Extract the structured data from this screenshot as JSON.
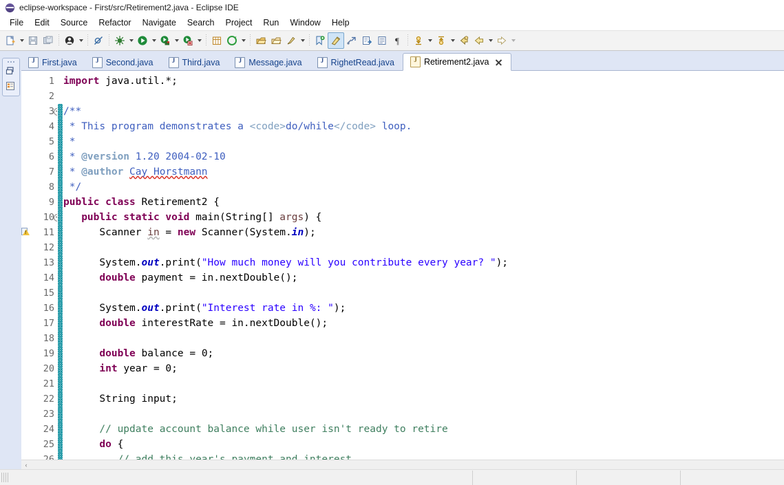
{
  "window": {
    "title": "eclipse-workspace - First/src/Retirement2.java - Eclipse IDE",
    "logo_icon": "eclipse-logo-icon"
  },
  "menubar": {
    "items": [
      {
        "label": "File"
      },
      {
        "label": "Edit"
      },
      {
        "label": "Source"
      },
      {
        "label": "Refactor"
      },
      {
        "label": "Navigate"
      },
      {
        "label": "Search"
      },
      {
        "label": "Project"
      },
      {
        "label": "Run"
      },
      {
        "label": "Window"
      },
      {
        "label": "Help"
      }
    ]
  },
  "toolbar": {
    "buttons": [
      {
        "name": "new-wizard-icon",
        "kind": "new"
      },
      {
        "name": "new-dropdown-caret",
        "kind": "caret"
      },
      {
        "name": "save-icon",
        "kind": "save"
      },
      {
        "name": "save-all-icon",
        "kind": "saveall"
      },
      {
        "name": "sep1",
        "kind": "sep"
      },
      {
        "name": "user-profile-icon",
        "kind": "user"
      },
      {
        "name": "user-dropdown-caret",
        "kind": "caret"
      },
      {
        "name": "sep2",
        "kind": "sep"
      },
      {
        "name": "skip-breakpoints-icon",
        "kind": "skipbreak"
      },
      {
        "name": "sep3",
        "kind": "sep"
      },
      {
        "name": "debug-icon",
        "kind": "debug"
      },
      {
        "name": "debug-dropdown-caret",
        "kind": "caret"
      },
      {
        "name": "run-icon",
        "kind": "run"
      },
      {
        "name": "run-dropdown-caret",
        "kind": "caret"
      },
      {
        "name": "run-external-tools-icon",
        "kind": "exttool"
      },
      {
        "name": "external-tools-caret",
        "kind": "caret"
      },
      {
        "name": "coverage-icon",
        "kind": "coverage"
      },
      {
        "name": "coverage-caret",
        "kind": "caret"
      },
      {
        "name": "sep4",
        "kind": "sep"
      },
      {
        "name": "new-java-package-icon",
        "kind": "package"
      },
      {
        "name": "new-java-project-icon",
        "kind": "project"
      },
      {
        "name": "project-caret",
        "kind": "caret"
      },
      {
        "name": "sep5",
        "kind": "sep"
      },
      {
        "name": "open-type-icon",
        "kind": "opentype"
      },
      {
        "name": "open-task-icon",
        "kind": "opentask"
      },
      {
        "name": "search-icon",
        "kind": "search"
      },
      {
        "name": "search-caret",
        "kind": "caret"
      },
      {
        "name": "sep6",
        "kind": "sep"
      },
      {
        "name": "new-annotation-icon",
        "kind": "annot"
      },
      {
        "name": "toggle-mark-occurrences-icon",
        "kind": "markocc",
        "selected": true
      },
      {
        "name": "link-with-editor-icon",
        "kind": "linkeditor"
      },
      {
        "name": "next-edit-location-icon",
        "kind": "nextedit"
      },
      {
        "name": "show-whitespace-icon",
        "kind": "whitespace"
      },
      {
        "name": "show-pilcrow-icon",
        "kind": "pilcrow"
      },
      {
        "name": "sep7",
        "kind": "sep"
      },
      {
        "name": "next-annotation-icon",
        "kind": "nextannot"
      },
      {
        "name": "next-annotation-caret",
        "kind": "caret"
      },
      {
        "name": "previous-annotation-icon",
        "kind": "prevannot"
      },
      {
        "name": "previous-annotation-caret",
        "kind": "caret"
      },
      {
        "name": "last-edit-location-icon",
        "kind": "lastedit"
      },
      {
        "name": "back-navigation-icon",
        "kind": "back"
      },
      {
        "name": "back-caret",
        "kind": "caret"
      },
      {
        "name": "forward-navigation-icon",
        "kind": "forward"
      },
      {
        "name": "forward-caret",
        "kind": "caret-dim"
      }
    ]
  },
  "left_rail": {
    "buttons": [
      {
        "name": "restore-view-icon"
      },
      {
        "name": "package-explorer-icon"
      }
    ]
  },
  "editor": {
    "tabs": [
      {
        "label": "First.java",
        "active": false
      },
      {
        "label": "Second.java",
        "active": false
      },
      {
        "label": "Third.java",
        "active": false
      },
      {
        "label": "Message.java",
        "active": false
      },
      {
        "label": "RighetRead.java",
        "active": false
      },
      {
        "label": "Retirement2.java",
        "active": true
      }
    ],
    "lines": [
      {
        "n": 1,
        "fold": false,
        "warn": false,
        "change": false,
        "tokens": [
          {
            "t": "import ",
            "c": "kw"
          },
          {
            "t": "java.util.*;",
            "c": ""
          }
        ]
      },
      {
        "n": 2,
        "fold": false,
        "warn": false,
        "change": false,
        "tokens": []
      },
      {
        "n": 3,
        "fold": true,
        "warn": false,
        "change": true,
        "tokens": [
          {
            "t": "/**",
            "c": "jdoc"
          }
        ]
      },
      {
        "n": 4,
        "fold": false,
        "warn": false,
        "change": true,
        "tokens": [
          {
            "t": " * ",
            "c": "jdoc"
          },
          {
            "t": "This program demonstrates a ",
            "c": "jdoc"
          },
          {
            "t": "<code>",
            "c": "jtag"
          },
          {
            "t": "do/while",
            "c": "jdoc"
          },
          {
            "t": "</code>",
            "c": "jtag"
          },
          {
            "t": " loop.",
            "c": "jdoc"
          }
        ]
      },
      {
        "n": 5,
        "fold": false,
        "warn": false,
        "change": true,
        "tokens": [
          {
            "t": " *",
            "c": "jdoc"
          }
        ]
      },
      {
        "n": 6,
        "fold": false,
        "warn": false,
        "change": true,
        "tokens": [
          {
            "t": " * ",
            "c": "jdoc"
          },
          {
            "t": "@version",
            "c": "jkey"
          },
          {
            "t": " 1.20 2004-02-10",
            "c": "jdoc"
          }
        ]
      },
      {
        "n": 7,
        "fold": false,
        "warn": false,
        "change": true,
        "tokens": [
          {
            "t": " * ",
            "c": "jdoc"
          },
          {
            "t": "@author",
            "c": "jkey"
          },
          {
            "t": " ",
            "c": "jdoc"
          },
          {
            "t": "Cay Horstmann",
            "c": "jdoc spell"
          }
        ]
      },
      {
        "n": 8,
        "fold": false,
        "warn": false,
        "change": true,
        "tokens": [
          {
            "t": " */",
            "c": "jdoc"
          }
        ]
      },
      {
        "n": 9,
        "fold": false,
        "warn": false,
        "change": true,
        "tokens": [
          {
            "t": "public class ",
            "c": "kw"
          },
          {
            "t": "Retirement2 {",
            "c": ""
          }
        ]
      },
      {
        "n": 10,
        "fold": true,
        "warn": false,
        "change": true,
        "tokens": [
          {
            "t": "   ",
            "c": ""
          },
          {
            "t": "public static void ",
            "c": "kw"
          },
          {
            "t": "main(String[] ",
            "c": ""
          },
          {
            "t": "args",
            "c": "loc"
          },
          {
            "t": ") {",
            "c": ""
          }
        ]
      },
      {
        "n": 11,
        "fold": false,
        "warn": true,
        "change": true,
        "tokens": [
          {
            "t": "      Scanner ",
            "c": ""
          },
          {
            "t": "in",
            "c": "loc spellgray"
          },
          {
            "t": " = ",
            "c": ""
          },
          {
            "t": "new ",
            "c": "kw"
          },
          {
            "t": "Scanner(System.",
            "c": ""
          },
          {
            "t": "in",
            "c": "fld"
          },
          {
            "t": ");",
            "c": ""
          }
        ]
      },
      {
        "n": 12,
        "fold": false,
        "warn": false,
        "change": true,
        "tokens": []
      },
      {
        "n": 13,
        "fold": false,
        "warn": false,
        "change": true,
        "tokens": [
          {
            "t": "      System.",
            "c": ""
          },
          {
            "t": "out",
            "c": "fld"
          },
          {
            "t": ".print(",
            "c": ""
          },
          {
            "t": "\"How much money will you contribute every year? \"",
            "c": "str"
          },
          {
            "t": ");",
            "c": ""
          }
        ]
      },
      {
        "n": 14,
        "fold": false,
        "warn": false,
        "change": true,
        "tokens": [
          {
            "t": "      ",
            "c": ""
          },
          {
            "t": "double ",
            "c": "kw"
          },
          {
            "t": "payment = in.nextDouble();",
            "c": ""
          }
        ]
      },
      {
        "n": 15,
        "fold": false,
        "warn": false,
        "change": true,
        "tokens": []
      },
      {
        "n": 16,
        "fold": false,
        "warn": false,
        "change": true,
        "tokens": [
          {
            "t": "      System.",
            "c": ""
          },
          {
            "t": "out",
            "c": "fld"
          },
          {
            "t": ".print(",
            "c": ""
          },
          {
            "t": "\"Interest rate in %: \"",
            "c": "str"
          },
          {
            "t": ");",
            "c": ""
          }
        ]
      },
      {
        "n": 17,
        "fold": false,
        "warn": false,
        "change": true,
        "tokens": [
          {
            "t": "      ",
            "c": ""
          },
          {
            "t": "double ",
            "c": "kw"
          },
          {
            "t": "interestRate = in.nextDouble();",
            "c": ""
          }
        ]
      },
      {
        "n": 18,
        "fold": false,
        "warn": false,
        "change": true,
        "tokens": []
      },
      {
        "n": 19,
        "fold": false,
        "warn": false,
        "change": true,
        "tokens": [
          {
            "t": "      ",
            "c": ""
          },
          {
            "t": "double ",
            "c": "kw"
          },
          {
            "t": "balance = ",
            "c": ""
          },
          {
            "t": "0",
            "c": ""
          },
          {
            "t": ";",
            "c": ""
          }
        ]
      },
      {
        "n": 20,
        "fold": false,
        "warn": false,
        "change": true,
        "tokens": [
          {
            "t": "      ",
            "c": ""
          },
          {
            "t": "int ",
            "c": "kw"
          },
          {
            "t": "year = ",
            "c": ""
          },
          {
            "t": "0",
            "c": ""
          },
          {
            "t": ";",
            "c": ""
          }
        ]
      },
      {
        "n": 21,
        "fold": false,
        "warn": false,
        "change": true,
        "tokens": []
      },
      {
        "n": 22,
        "fold": false,
        "warn": false,
        "change": true,
        "tokens": [
          {
            "t": "      String input;",
            "c": ""
          }
        ]
      },
      {
        "n": 23,
        "fold": false,
        "warn": false,
        "change": true,
        "tokens": []
      },
      {
        "n": 24,
        "fold": false,
        "warn": false,
        "change": true,
        "tokens": [
          {
            "t": "      ",
            "c": ""
          },
          {
            "t": "// update account balance while user isn't ready to retire",
            "c": "cmt"
          }
        ]
      },
      {
        "n": 25,
        "fold": false,
        "warn": false,
        "change": true,
        "tokens": [
          {
            "t": "      ",
            "c": ""
          },
          {
            "t": "do ",
            "c": "kw"
          },
          {
            "t": "{",
            "c": ""
          }
        ]
      },
      {
        "n": 26,
        "fold": false,
        "warn": false,
        "change": true,
        "tokens": [
          {
            "t": "         ",
            "c": ""
          },
          {
            "t": "// add this year's payment and interest",
            "c": "cmt"
          }
        ]
      }
    ],
    "hscroll": {
      "left_arrow": "‹"
    }
  },
  "statusbar": {
    "segments": [
      {
        "name": "status-segment-1",
        "label": ""
      },
      {
        "name": "status-segment-2",
        "label": ""
      },
      {
        "name": "status-segment-3",
        "label": ""
      }
    ]
  }
}
